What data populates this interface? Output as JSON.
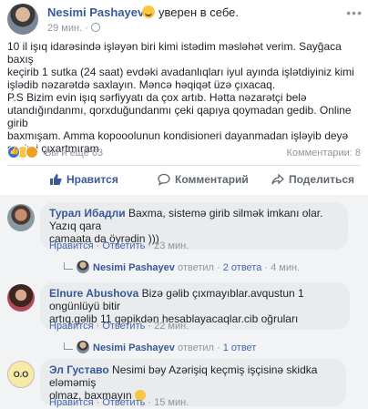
{
  "post": {
    "author": "Nesimi Pashayev",
    "feeling": "уверен в себе.",
    "time": "29 мин. ·",
    "text_lines": [
      "10 il işıq idarəsində işləyən biri kimi istədim məsləhət verim. Sayğaca baxış",
      "keçirib 1 sutka (24 saat) evdəki avadanlıqları iyul ayında işlətdiyiniz kimi",
      "işlədib nəzarətdə saxlayın. Məncə həqiqət üzə çıxacaq.",
      "P.S Bizim evin işıq sərfiyyatı da çox artıb. Hətta nəzarətçi belə",
      "utandığındanmı, qorxduğundanmı çeki qapıya qoymadan gedib. Online girib",
      "baxmışam. Amma kopooolunun kondisioneri dayanmadan işləyib deyə",
      "səsimi çıxartmıram"
    ],
    "reactions_label": "Вы и ещё 63",
    "comments_count": "Комментарии: 8"
  },
  "actions": {
    "like": "Нравится",
    "comment": "Комментарий",
    "share": "Поделиться"
  },
  "comments": [
    {
      "name": "Турал Ибадли",
      "text_lines": [
        "Baxma, sistemə girib silmək imkanı olar. Yazıq qara",
        "camaata da öyrədin )))"
      ],
      "like": "Нравится",
      "reply": "Ответить",
      "time": "23 мин.",
      "reply_author": "Nesimi Pashayev",
      "reply_verb": "ответил",
      "reply_count": "2 ответа",
      "reply_time": "4 мин."
    },
    {
      "name": "Elnure Abushova",
      "text_lines": [
        "Bizə gəlib çıxmayıblar.avqustun 1 ongünlüyü bitir",
        "artıq.gəlib 11 qəpikdən hesablayacaqlar.cib oğruları"
      ],
      "like": "Нравится",
      "reply": "Ответить",
      "time": "22 мин.",
      "reply_author": "Nesimi Pashayev",
      "reply_verb": "ответил",
      "reply_count": "1 ответ",
      "reply_time": ""
    },
    {
      "name": "Эл Густаво",
      "avatar_text": "O.O",
      "text_lines": [
        "Nesimi bəy Azərişiq keçmiş işçisinə skidka eləməmiş",
        "olmaz, baxmayın"
      ],
      "like": "Нравится",
      "reply": "Ответить",
      "time": "15 мин."
    }
  ]
}
